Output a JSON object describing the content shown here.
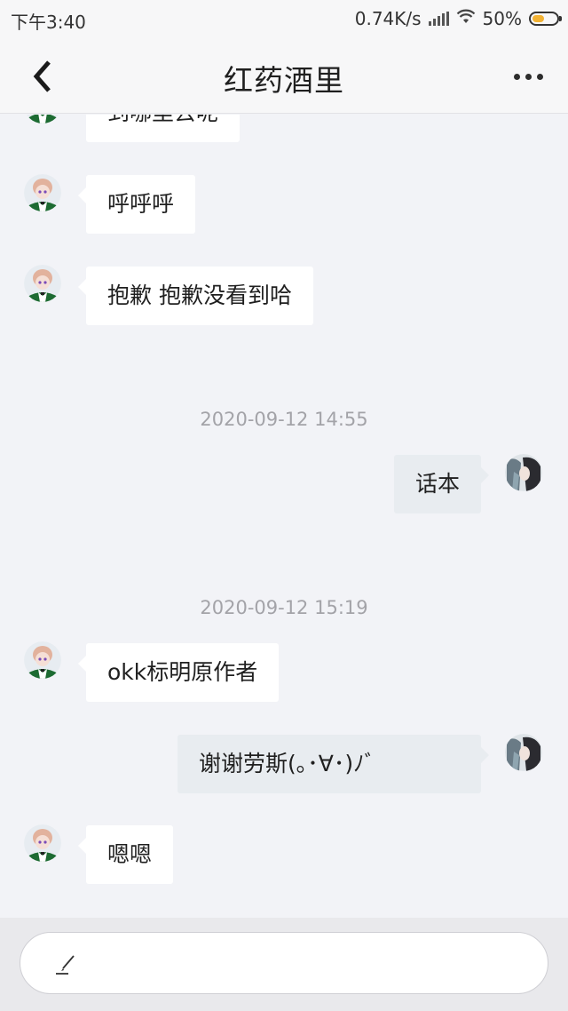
{
  "status_bar": {
    "time": "下午3:40",
    "network_speed": "0.74K/s",
    "battery_percent": "50%",
    "battery_level": 0.5
  },
  "header": {
    "title": "红药酒里",
    "back_icon": "chevron-left-icon",
    "more_icon": "more-horizontal-icon"
  },
  "messages": [
    {
      "sender": "other",
      "text": "到哪里去呢"
    },
    {
      "sender": "other",
      "text": "呼呼呼"
    },
    {
      "sender": "other",
      "text": "抱歉 抱歉没看到哈"
    },
    {
      "type": "timestamp",
      "text": "2020-09-12 14:55"
    },
    {
      "sender": "me",
      "text": "话本"
    },
    {
      "type": "timestamp",
      "text": "2020-09-12 15:19"
    },
    {
      "sender": "other",
      "text": "okk标明原作者"
    },
    {
      "sender": "me",
      "text": "谢谢劳斯(｡･∀･)ﾉﾞ"
    },
    {
      "sender": "other",
      "text": "嗯嗯"
    }
  ],
  "input": {
    "icon": "pen-icon"
  },
  "colors": {
    "background": "#f2f3f7",
    "incoming_bubble": "#ffffff",
    "outgoing_bubble": "#e8ecf0",
    "timestamp_text": "#a3a3a8"
  }
}
